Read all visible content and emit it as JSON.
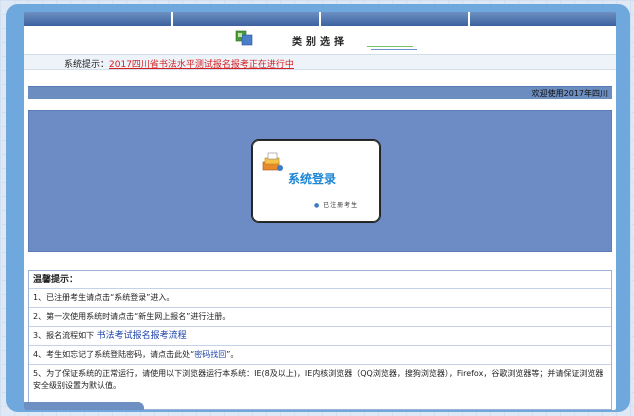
{
  "category": {
    "title": "类别选择"
  },
  "notice": {
    "label": "系统提示：",
    "link_text": "2017四川省书法水平测试报名报考正在进行中"
  },
  "welcome": {
    "text": "欢迎使用2017年四川"
  },
  "login": {
    "title": "系统登录",
    "subtitle": "已注册考生"
  },
  "tips": {
    "heading": "温馨提示：",
    "row1": "1、已注册考生请点击“系统登录”进入。",
    "row2": "2、第一次使用系统时请点击“新生网上报名”进行注册。",
    "row3_prefix": "3、报名流程如下 ",
    "row3_link": "书法考试报名报考流程",
    "row4_prefix": "4、考生如忘记了系统登陆密码，请点击此处“",
    "row4_link": "密码找回",
    "row4_suffix": "”。",
    "row5": "5、为了保证系统的正常运行，请使用以下浏览器运行本系统：IE(8及以上)，IE内核浏览器（QQ浏览器，搜狗浏览器），Firefox，谷歌浏览器等；并请保证浏览器安全级别设置为默认值。"
  },
  "colors": {
    "frame": "#6ea8dc",
    "panel": "#6d8cc6",
    "notice_link": "#d42020",
    "login_title": "#1e86d6"
  }
}
